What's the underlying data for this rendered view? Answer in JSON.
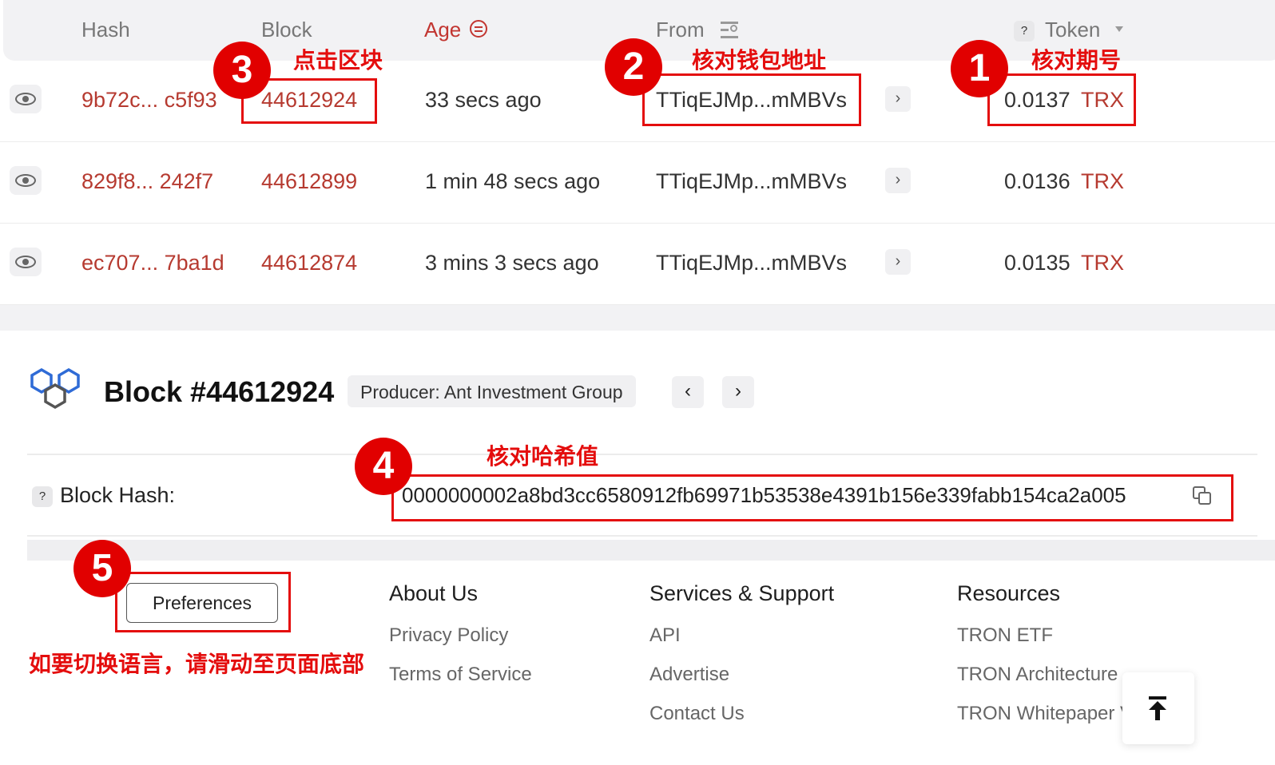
{
  "table": {
    "headers": {
      "hash": "Hash",
      "block": "Block",
      "age": "Age",
      "from": "From",
      "token_q": "?",
      "token": "Token"
    },
    "rows": [
      {
        "hash": "9b72c... c5f93",
        "block": "44612924",
        "age": "33 secs ago",
        "from": "TTiqEJMp...mMBVs",
        "amount": "0.0137",
        "token": "TRX"
      },
      {
        "hash": "829f8... 242f7",
        "block": "44612899",
        "age": "1 min 48 secs ago",
        "from": "TTiqEJMp...mMBVs",
        "amount": "0.0136",
        "token": "TRX"
      },
      {
        "hash": "ec707... 7ba1d",
        "block": "44612874",
        "age": "3 mins 3 secs ago",
        "from": "TTiqEJMp...mMBVs",
        "amount": "0.0135",
        "token": "TRX"
      }
    ]
  },
  "block": {
    "title": "Block  #44612924",
    "producer": "Producer: Ant Investment Group",
    "prev_symbol": "‹",
    "next_symbol": "›",
    "hash_q": "?",
    "hash_label": "Block Hash:",
    "hash_value": "0000000002a8bd3cc6580912fb69971b53538e4391b156e339fabb154ca2a005"
  },
  "footer": {
    "preferences": "Preferences",
    "columns": [
      {
        "heading": "About Us",
        "links": [
          "Privacy Policy",
          "Terms of Service"
        ]
      },
      {
        "heading": "Services & Support",
        "links": [
          "API",
          "Advertise",
          "Contact Us"
        ]
      },
      {
        "heading": "Resources",
        "links": [
          "TRON ETF",
          "TRON Architecture",
          "TRON Whitepaper V"
        ]
      }
    ]
  },
  "annotations": {
    "n1": "1",
    "t1": "核对期号",
    "n2": "2",
    "t2": "核对钱包地址",
    "n3": "3",
    "t3": "点击区块",
    "n4": "4",
    "t4": "核对哈希值",
    "n5": "5",
    "t5": "如要切换语言，请滑动至页面底部"
  },
  "colors": {
    "link_red": "#b63a30",
    "annotation_red": "#e40d0d",
    "logo_blue": "#2f6bd6"
  }
}
